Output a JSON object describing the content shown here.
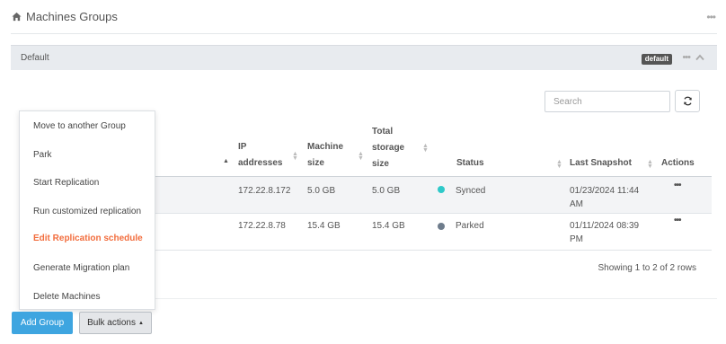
{
  "page": {
    "title": "Machines Groups",
    "menu_glyph": "•••"
  },
  "group": {
    "name": "Default",
    "badge": "default",
    "menu_glyph": "•••"
  },
  "search": {
    "placeholder": "Search",
    "value": ""
  },
  "table": {
    "columns": [
      {
        "label": "IP addresses",
        "line1": "IP",
        "line2": "addresses"
      },
      {
        "label": "Machine size",
        "line1": "Machine",
        "line2": "size"
      },
      {
        "label": "Total storage size",
        "line1": "Total",
        "line2": "storage",
        "line3": "size"
      },
      {
        "label": "Status"
      },
      {
        "label": "Last Snapshot"
      },
      {
        "label": "Actions"
      }
    ],
    "rows": [
      {
        "ip": "172.22.8.172",
        "machine_size": "5.0 GB",
        "total_storage": "5.0 GB",
        "status": "Synced",
        "status_color": "#2ec9c9",
        "snapshot_date": "01/23/2024 11:44",
        "snapshot_ampm": "AM",
        "actions_glyph": "•••"
      },
      {
        "ip": "172.22.8.78",
        "machine_size": "15.4 GB",
        "total_storage": "15.4 GB",
        "status": "Parked",
        "status_color": "#6e7c8c",
        "snapshot_date": "01/11/2024 08:39",
        "snapshot_ampm": "PM",
        "actions_glyph": "•••"
      }
    ],
    "info": "Showing 1 to 2 of 2 rows"
  },
  "bulk_menu": {
    "items": [
      "Move to another Group",
      "Park",
      "Start Replication",
      "Run customized replication",
      "Edit Replication schedule",
      "Generate Migration plan",
      "Delete Machines"
    ],
    "active_index": 4
  },
  "footer": {
    "add_group": "Add Group",
    "bulk_actions": "Bulk actions"
  },
  "colors": {
    "primary": "#3ea5e0",
    "highlight": "#f26d3d",
    "synced": "#2ec9c9",
    "parked": "#6e7c8c"
  }
}
